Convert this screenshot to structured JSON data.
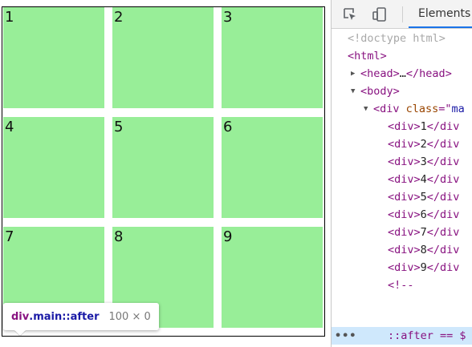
{
  "viewport": {
    "cells": [
      "1",
      "2",
      "3",
      "4",
      "5",
      "6",
      "7",
      "8",
      "9"
    ],
    "tooltip": {
      "tag": "div",
      "class_part": ".main::after",
      "dimensions": "100 × 0"
    }
  },
  "devtools": {
    "toolbar": {
      "inspect_icon": "inspect-element-icon",
      "device_icon": "device-toolbar-icon",
      "elements_tab": "Elements"
    },
    "dom": {
      "doctype": "<!doctype html>",
      "html_open": "<html>",
      "head_open": "<head>",
      "head_ellipsis": "…",
      "head_close": "</head>",
      "body_open": "<body>",
      "div_open": "<div ",
      "div_attr": "class",
      "div_eq": "=\"",
      "div_val": "ma",
      "children": [
        {
          "open": "<div>",
          "text": "1",
          "close": "</div"
        },
        {
          "open": "<div>",
          "text": "2",
          "close": "</div"
        },
        {
          "open": "<div>",
          "text": "3",
          "close": "</div"
        },
        {
          "open": "<div>",
          "text": "4",
          "close": "</div"
        },
        {
          "open": "<div>",
          "text": "5",
          "close": "</div"
        },
        {
          "open": "<div>",
          "text": "6",
          "close": "</div"
        },
        {
          "open": "<div>",
          "text": "7",
          "close": "</div"
        },
        {
          "open": "<div>",
          "text": "8",
          "close": "</div"
        },
        {
          "open": "<div>",
          "text": "9",
          "close": "</div"
        }
      ],
      "comment": "<!--",
      "selected_dots": "•••",
      "selected_text": "::after == $"
    }
  },
  "colors": {
    "cell_fill": "#98ee98",
    "selection": "#cfe8fc",
    "tag": "#881280",
    "attr": "#994500",
    "value": "#1a1aa6"
  }
}
